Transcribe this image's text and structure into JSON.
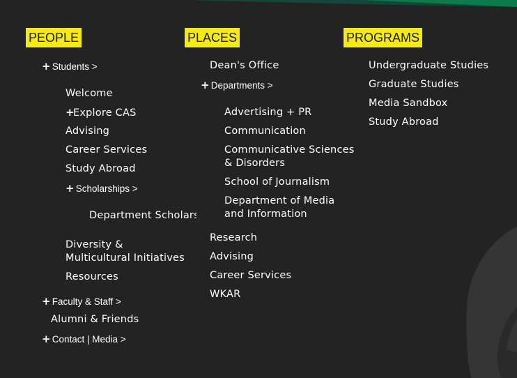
{
  "colors": {
    "background": "#232323",
    "header_highlight": "#f5ea14",
    "brand_green": "#18453b",
    "text": "#ffffff"
  },
  "people": {
    "title": "PEOPLE",
    "students_toggle": "Students >",
    "students": {
      "welcome": "Welcome",
      "explore_cas": "Explore CAS",
      "advising": "Advising",
      "career_services": "Career Services",
      "study_abroad": "Study Abroad",
      "scholarships_toggle": "Scholarships >",
      "department_scholarships": "Department Scholars",
      "diversity": "Diversity & Multicultural Initiatives",
      "resources": "Resources"
    },
    "faculty_toggle": "Faculty & Staff >",
    "alumni": "Alumni & Friends",
    "contact_toggle": "Contact | Media >"
  },
  "places": {
    "title": "PLACES",
    "deans_office": "Dean's Office",
    "departments_toggle": "Departments >",
    "departments": {
      "advertising": "Advertising + PR",
      "communication": "Communication",
      "comm_sciences": "Communicative Sciences & Disorders",
      "journalism": "School of Journalism",
      "media_info": "Department of Media and Information"
    },
    "research": "Research",
    "advising": "Advising",
    "career_services": "Career Services",
    "wkar": "WKAR"
  },
  "programs": {
    "title": "PROGRAMS",
    "items": [
      "Undergraduate Studies",
      "Graduate Studies",
      "Media Sandbox",
      "Study Abroad"
    ]
  },
  "icons": {
    "plus": "+"
  }
}
